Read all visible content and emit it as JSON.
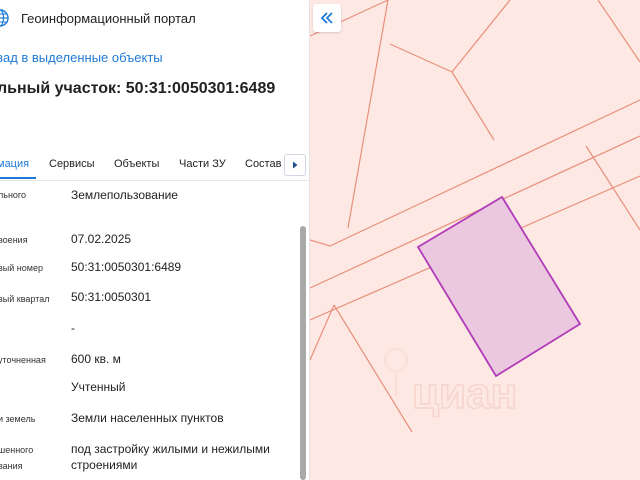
{
  "header": {
    "portal_title": "Геоинформационный портал",
    "logo_icon": "globe-icon",
    "brand_color": "#1f7ad6"
  },
  "back_link": "зад в выделенные объекты",
  "parcel_title": "льный участок: 50:31:0050301:6489",
  "tabs": [
    {
      "label": "мация",
      "active": true
    },
    {
      "label": "Сервисы",
      "active": false
    },
    {
      "label": "Объекты",
      "active": false
    },
    {
      "label": "Части ЗУ",
      "active": false
    },
    {
      "label": "Состав",
      "active": false
    }
  ],
  "tab_scroll_icon": "chevron-right-icon",
  "attributes": [
    {
      "label": "льного",
      "value": "Землепользование"
    },
    {
      "label": "воения",
      "value": "07.02.2025"
    },
    {
      "label": "вый номер",
      "value": "50:31:0050301:6489"
    },
    {
      "label": "вый квартал",
      "value": "50:31:0050301"
    },
    {
      "label": "",
      "value": "-"
    },
    {
      "label": "уточненная",
      "value": "600 кв. м"
    },
    {
      "label": "",
      "value": "Учтенный"
    },
    {
      "label": "и земель",
      "value": "Земли населенных пунктов"
    },
    {
      "label": "шенного",
      "label2": "вания",
      "value": "под застройку жилыми и нежилыми",
      "value2": "строениями"
    }
  ],
  "map": {
    "collapse_icon": "double-chevron-left-icon",
    "watermark": "циан",
    "background_color": "#fde8e3",
    "boundary_color": "#e8907a",
    "selected_fill": "#ecc7e0",
    "selected_stroke": "#b03cb8"
  }
}
